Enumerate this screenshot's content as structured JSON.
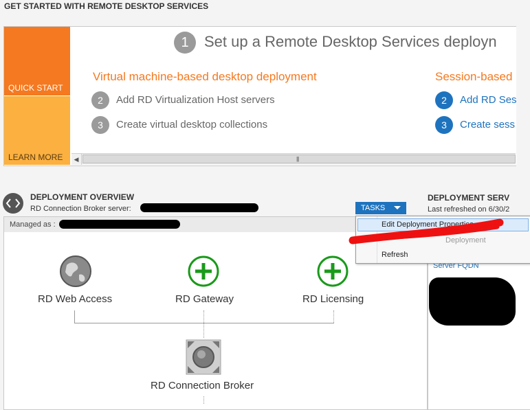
{
  "header": {
    "title": "GET STARTED WITH REMOTE DESKTOP SERVICES"
  },
  "quickstart": {
    "tiles": {
      "quick_start": "QUICK START",
      "learn_more": "LEARN MORE"
    },
    "step1": {
      "num": "1",
      "title": "Set up a Remote Desktop Services deployn"
    },
    "vm_section": {
      "title": "Virtual machine-based desktop deployment",
      "steps": [
        {
          "num": "2",
          "label": "Add RD Virtualization Host servers"
        },
        {
          "num": "3",
          "label": "Create virtual desktop collections"
        }
      ]
    },
    "session_section": {
      "title": "Session-based",
      "steps": [
        {
          "num": "2",
          "label": "Add RD Ses"
        },
        {
          "num": "3",
          "label": "Create sess"
        }
      ]
    }
  },
  "overview": {
    "title": "DEPLOYMENT OVERVIEW",
    "broker_label": "RD Connection Broker server:",
    "tasks_label": "TASKS",
    "managed_label": "Managed as :",
    "nodes": {
      "web_access": "RD Web Access",
      "gateway": "RD Gateway",
      "licensing": "RD Licensing",
      "broker": "RD Connection Broker"
    }
  },
  "servers": {
    "title": "DEPLOYMENT SERV",
    "refreshed": "Last refreshed on 6/30/2",
    "fqdn_header": "Server FQDN"
  },
  "tasks_menu": {
    "items": [
      "Edit Deployment Properties",
      "Deployment",
      "Refresh"
    ]
  },
  "colors": {
    "accent_blue": "#1e73be",
    "accent_orange": "#f47920",
    "add_green": "#1a9a1a"
  }
}
